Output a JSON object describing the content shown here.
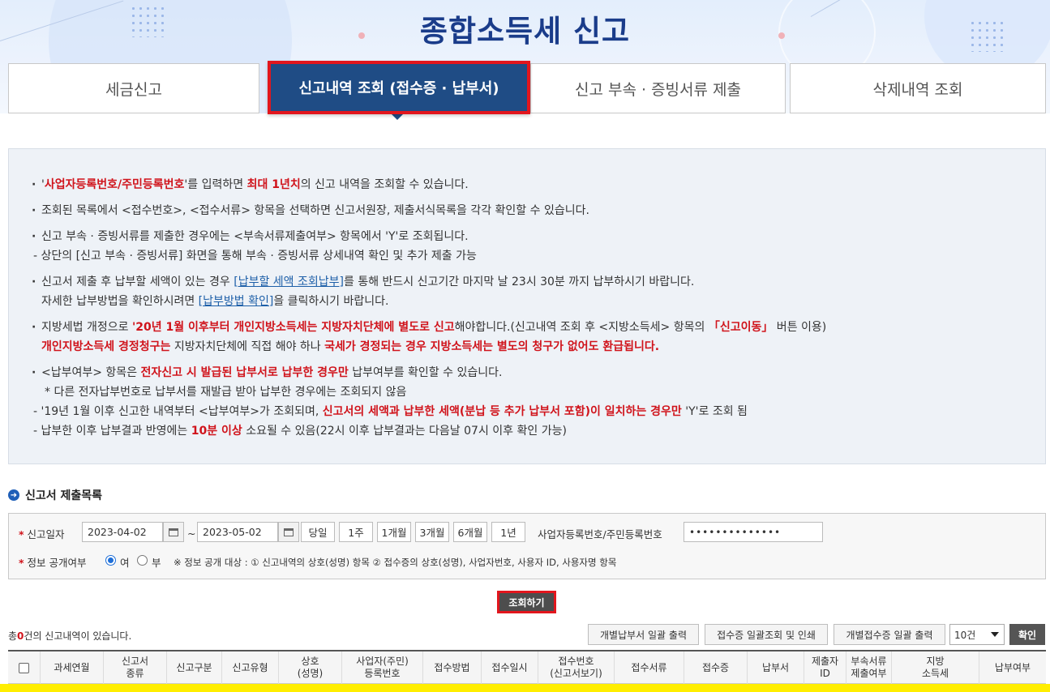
{
  "header": {
    "title": "종합소득세 신고"
  },
  "tabs": [
    {
      "label": "세금신고"
    },
    {
      "label": "신고내역 조회 (접수증 · 납부서)"
    },
    {
      "label": "신고 부속 · 증빙서류 제출"
    },
    {
      "label": "삭제내역 조회"
    }
  ],
  "notice": {
    "l1_a": "'",
    "l1_b": "사업자등록번호/주민등록번호",
    "l1_c": "'를 입력하면 ",
    "l1_d": "최대 1년치",
    "l1_e": "의 신고 내역을 조회할 수 있습니다.",
    "l2": "조회된 목록에서 <접수번호>, <접수서류> 항목을 선택하면 신고서원장, 제출서식목록을 각각 확인할 수 있습니다.",
    "l3": "신고 부속 · 증빙서류를 제출한 경우에는 <부속서류제출여부> 항목에서 'Y'로 조회됩니다.",
    "l3_sub": "- 상단의 [신고 부속 · 증빙서류] 화면을 통해 부속 · 증빙서류 상세내역 확인 및 추가 제출 가능",
    "l4_a": "신고서 제출 후 납부할 세액이 있는 경우 ",
    "l4_link": "[납부할 세액 조회납부]",
    "l4_b": "를 통해 반드시 신고기간 마지막 날 23시 30분 까지 납부하시기 바랍니다.",
    "l4_sub_a": "자세한 납부방법을 확인하시려면 ",
    "l4_sub_link": "[납부방법 확인]",
    "l4_sub_b": "을 클릭하시기 바랍니다.",
    "l5_a": "지방세법 개정으로 ",
    "l5_b": "'20년 1월 이후부터 개인지방소득세는 지방자치단체에 별도로 신고",
    "l5_c": "해야합니다.(신고내역 조회 후 <지방소득세> 항목의 ",
    "l5_d": "「신고이동」",
    "l5_e": " 버튼 이용)",
    "l5_sub_a": "개인지방소득세 경정청구는",
    "l5_sub_b": " 지방자치단체에 직접 해야 하나 ",
    "l5_sub_c": "국세가 경정되는 경우 지방소득세는 별도의 청구가 없어도 환급됩니다.",
    "l6_a": "<납부여부> 항목은 ",
    "l6_b": "전자신고 시 발급된 납부서로 납부한 경우만",
    "l6_c": " 납부여부를 확인할 수 있습니다.",
    "l6_s1": "* 다른 전자납부번호로 납부서를 재발급 받아 납부한 경우에는 조회되지 않음",
    "l6_s2_a": "- '19년 1월 이후 신고한 내역부터 <납부여부>가 조회되며, ",
    "l6_s2_b": "신고서의 세액과 납부한 세액(분납 등 추가 납부서 포함)이 일치하는 경우만",
    "l6_s2_c": " 'Y'로 조회 됨",
    "l6_s3_a": "- 납부한 이후 납부결과 반영에는 ",
    "l6_s3_b": "10분 이상",
    "l6_s3_c": " 소요될 수 있음(22시 이후 납부결과는 다음날 07시 이후 확인 가능)"
  },
  "section": {
    "title": "신고서 제출목록"
  },
  "search": {
    "date_label": "신고일자",
    "date_from": "2023-04-02",
    "tilde": "~",
    "date_to": "2023-05-02",
    "periods": [
      "당일",
      "1주",
      "1개월",
      "3개월",
      "6개월",
      "1년"
    ],
    "id_label": "사업자등록번호/주민등록번호",
    "id_value": "••••••••••••••",
    "public_label": "정보 공개여부",
    "opt_yes": "여",
    "opt_no": "부",
    "note": "※ 정보 공개 대상 : ① 신고내역의 상호(성명) 항목 ② 접수증의 상호(성명), 사업자번호, 사용자 ID, 사용자명 항목"
  },
  "search_button": "조회하기",
  "results": {
    "prefix": "총",
    "count": "0",
    "suffix": "건의 신고내역이 있습니다.",
    "btn_bill": "개별납부서 일괄 출력",
    "btn_receipt": "접수증 일괄조회 및 인쇄",
    "btn_individual": "개별접수증 일괄 출력",
    "page_size": "10건",
    "ok": "확인"
  },
  "table": {
    "columns": [
      "과세연월",
      "신고서\n종류",
      "신고구분",
      "신고유형",
      "상호\n(성명)",
      "사업자(주민)\n등록번호",
      "접수방법",
      "접수일시",
      "접수번호\n(신고서보기)",
      "접수서류",
      "접수증",
      "납부서",
      "제출자\nID",
      "부속서류\n제출여부",
      "지방\n소득세",
      "납부여부"
    ]
  }
}
